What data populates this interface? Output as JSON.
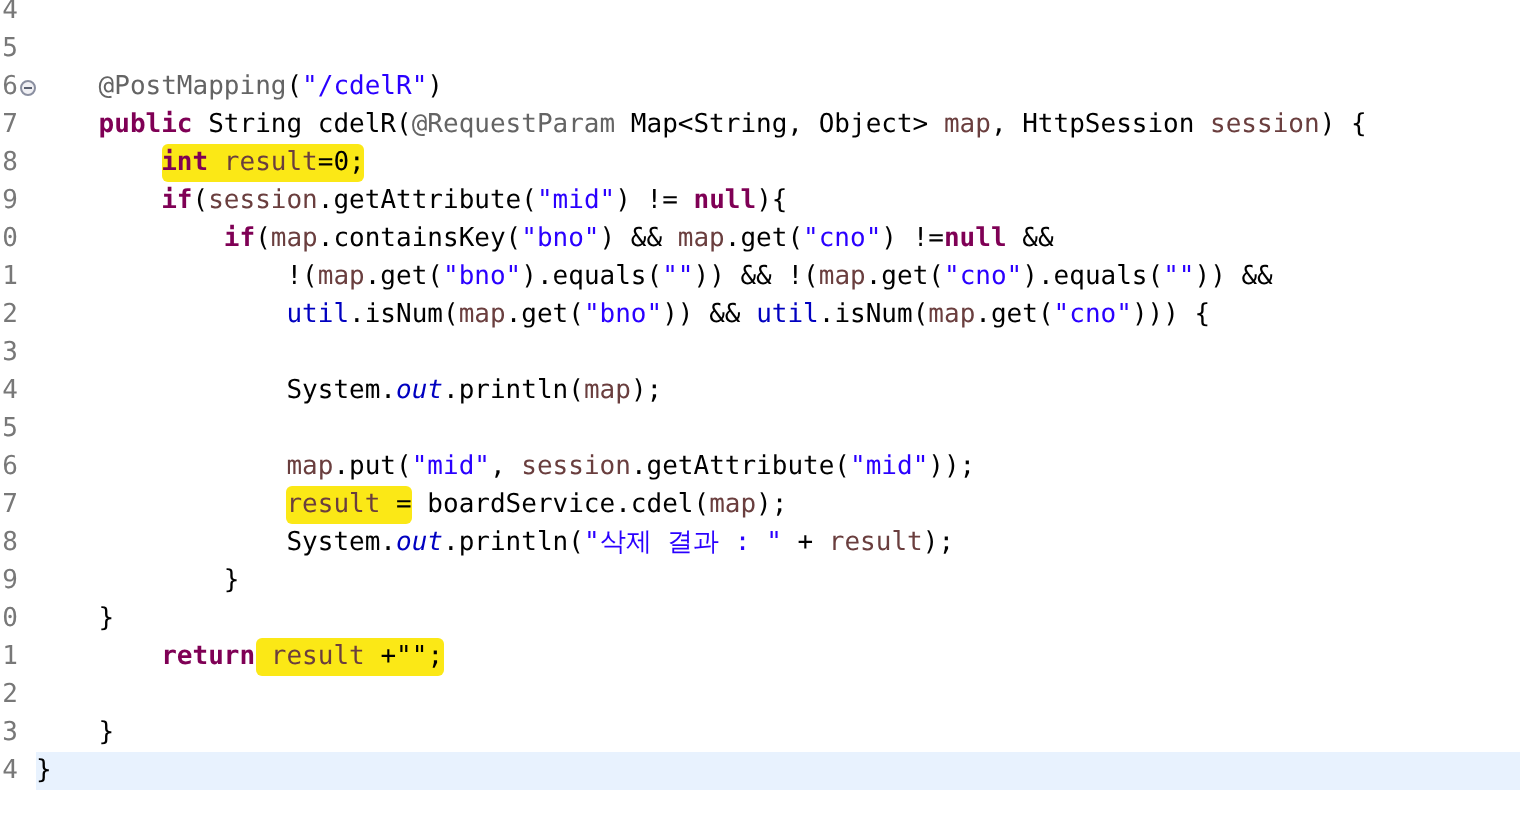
{
  "editor": {
    "lines": [
      {
        "number": "4",
        "fold": false,
        "current": false
      },
      {
        "number": "5",
        "fold": false,
        "current": false
      },
      {
        "children": [
          {
            "number": "6",
            "fold": true,
            "current": false,
            "segments": [
              {
                "marked": false,
                "tokens": [
                  {
                    "t": "@PostMapping",
                    "kind": "annotation"
                  },
                  {
                    "t": "(",
                    "kind": "plain"
                  },
                  {
                    "t": "\"/cdelR\"",
                    "kind": "string"
                  },
                  {
                    "t": ")",
                    "kind": "plain"
                  }
                ]
              }
            ]
          },
          {
            "number": "7",
            "fold": false,
            "current": false,
            "segments": [
              {
                "marked": false,
                "tokens": [
                  {
                    "t": "public",
                    "kind": "keyword"
                  },
                  {
                    "t": " String cdelR(",
                    "kind": "plain"
                  },
                  {
                    "t": "@RequestParam",
                    "kind": "annotation"
                  },
                  {
                    "t": " Map<String, Object> ",
                    "kind": "plain"
                  },
                  {
                    "t": "map",
                    "kind": "variable"
                  },
                  {
                    "t": ", HttpSession ",
                    "kind": "plain"
                  },
                  {
                    "t": "session",
                    "kind": "variable"
                  },
                  {
                    "t": ") {",
                    "kind": "plain"
                  }
                ]
              }
            ]
          },
          {
            "children": [
              {
                "number": "8",
                "fold": false,
                "current": false,
                "segments": [
                  {
                    "marked": true,
                    "tokens": [
                      {
                        "t": "int",
                        "kind": "keyword"
                      },
                      {
                        "t": " result",
                        "kind": "variable"
                      },
                      {
                        "t": "=0;",
                        "kind": "plain"
                      }
                    ]
                  }
                ]
              },
              {
                "number": "9",
                "fold": false,
                "current": false,
                "segments": [
                  {
                    "marked": false,
                    "tokens": [
                      {
                        "t": "if",
                        "kind": "keyword"
                      },
                      {
                        "t": "(",
                        "kind": "plain"
                      },
                      {
                        "t": "session",
                        "kind": "variable"
                      },
                      {
                        "t": ".getAttribute(",
                        "kind": "plain"
                      },
                      {
                        "t": "\"mid\"",
                        "kind": "string"
                      },
                      {
                        "t": ") != ",
                        "kind": "plain"
                      },
                      {
                        "t": "null",
                        "kind": "keyword"
                      },
                      {
                        "t": "){",
                        "kind": "plain"
                      }
                    ]
                  }
                ]
              },
              {
                "children": [
                  {
                    "number": "0",
                    "fold": false,
                    "current": false,
                    "segments": [
                      {
                        "marked": false,
                        "tokens": [
                          {
                            "t": "if",
                            "kind": "keyword"
                          },
                          {
                            "t": "(",
                            "kind": "plain"
                          },
                          {
                            "t": "map",
                            "kind": "variable"
                          },
                          {
                            "t": ".containsKey(",
                            "kind": "plain"
                          },
                          {
                            "t": "\"bno\"",
                            "kind": "string"
                          },
                          {
                            "t": ") && ",
                            "kind": "plain"
                          },
                          {
                            "t": "map",
                            "kind": "variable"
                          },
                          {
                            "t": ".get(",
                            "kind": "plain"
                          },
                          {
                            "t": "\"cno\"",
                            "kind": "string"
                          },
                          {
                            "t": ") !=",
                            "kind": "plain"
                          },
                          {
                            "t": "null",
                            "kind": "keyword"
                          },
                          {
                            "t": " &&",
                            "kind": "plain"
                          }
                        ]
                      }
                    ]
                  },
                  {
                    "children": [
                      {
                        "number": "1",
                        "fold": false,
                        "current": false,
                        "segments": [
                          {
                            "marked": false,
                            "tokens": [
                              {
                                "t": "!(",
                                "kind": "plain"
                              },
                              {
                                "t": "map",
                                "kind": "variable"
                              },
                              {
                                "t": ".get(",
                                "kind": "plain"
                              },
                              {
                                "t": "\"bno\"",
                                "kind": "string"
                              },
                              {
                                "t": ").equals(",
                                "kind": "plain"
                              },
                              {
                                "t": "\"\"",
                                "kind": "string"
                              },
                              {
                                "t": ")) && !(",
                                "kind": "plain"
                              },
                              {
                                "t": "map",
                                "kind": "variable"
                              },
                              {
                                "t": ".get(",
                                "kind": "plain"
                              },
                              {
                                "t": "\"cno\"",
                                "kind": "string"
                              },
                              {
                                "t": ").equals(",
                                "kind": "plain"
                              },
                              {
                                "t": "\"\"",
                                "kind": "string"
                              },
                              {
                                "t": ")) &&",
                                "kind": "plain"
                              }
                            ]
                          }
                        ]
                      },
                      {
                        "number": "2",
                        "fold": false,
                        "current": false,
                        "segments": [
                          {
                            "marked": false,
                            "tokens": [
                              {
                                "t": "util",
                                "kind": "field"
                              },
                              {
                                "t": ".isNum(",
                                "kind": "plain"
                              },
                              {
                                "t": "map",
                                "kind": "variable"
                              },
                              {
                                "t": ".get(",
                                "kind": "plain"
                              },
                              {
                                "t": "\"bno\"",
                                "kind": "string"
                              },
                              {
                                "t": ")) && ",
                                "kind": "plain"
                              },
                              {
                                "t": "util",
                                "kind": "field"
                              },
                              {
                                "t": ".isNum(",
                                "kind": "plain"
                              },
                              {
                                "t": "map",
                                "kind": "variable"
                              },
                              {
                                "t": ".get(",
                                "kind": "plain"
                              },
                              {
                                "t": "\"cno\"",
                                "kind": "string"
                              },
                              {
                                "t": "))) {",
                                "kind": "plain"
                              }
                            ]
                          }
                        ]
                      },
                      {
                        "number": "3",
                        "fold": false,
                        "current": false
                      },
                      {
                        "number": "4",
                        "fold": false,
                        "current": false,
                        "segments": [
                          {
                            "marked": false,
                            "tokens": [
                              {
                                "t": "System.",
                                "kind": "plain"
                              },
                              {
                                "t": "out",
                                "kind": "static"
                              },
                              {
                                "t": ".println(",
                                "kind": "plain"
                              },
                              {
                                "t": "map",
                                "kind": "variable"
                              },
                              {
                                "t": ");",
                                "kind": "plain"
                              }
                            ]
                          }
                        ]
                      },
                      {
                        "number": "5",
                        "fold": false,
                        "current": false
                      },
                      {
                        "number": "6",
                        "fold": false,
                        "current": false,
                        "segments": [
                          {
                            "marked": false,
                            "tokens": [
                              {
                                "t": "map",
                                "kind": "variable"
                              },
                              {
                                "t": ".put(",
                                "kind": "plain"
                              },
                              {
                                "t": "\"mid\"",
                                "kind": "string"
                              },
                              {
                                "t": ", ",
                                "kind": "plain"
                              },
                              {
                                "t": "session",
                                "kind": "variable"
                              },
                              {
                                "t": ".getAttribute(",
                                "kind": "plain"
                              },
                              {
                                "t": "\"mid\"",
                                "kind": "string"
                              },
                              {
                                "t": "));",
                                "kind": "plain"
                              }
                            ]
                          }
                        ]
                      },
                      {
                        "number": "7",
                        "fold": false,
                        "current": false,
                        "segments": [
                          {
                            "marked": true,
                            "tokens": [
                              {
                                "t": "result",
                                "kind": "variable"
                              },
                              {
                                "t": " =",
                                "kind": "plain"
                              }
                            ]
                          },
                          {
                            "marked": false,
                            "tokens": [
                              {
                                "t": " boardService.cdel(",
                                "kind": "plain"
                              },
                              {
                                "t": "map",
                                "kind": "variable"
                              },
                              {
                                "t": ");",
                                "kind": "plain"
                              }
                            ]
                          }
                        ]
                      },
                      {
                        "number": "8",
                        "fold": false,
                        "current": false,
                        "segments": [
                          {
                            "marked": false,
                            "tokens": [
                              {
                                "t": "System.",
                                "kind": "plain"
                              },
                              {
                                "t": "out",
                                "kind": "static"
                              },
                              {
                                "t": ".println(",
                                "kind": "plain"
                              },
                              {
                                "t": "\"삭제 결과 : \"",
                                "kind": "string"
                              },
                              {
                                "t": " + ",
                                "kind": "plain"
                              },
                              {
                                "t": "result",
                                "kind": "variable"
                              },
                              {
                                "t": ");",
                                "kind": "plain"
                              }
                            ]
                          }
                        ]
                      }
                    ]
                  },
                  {
                    "number": "9",
                    "fold": false,
                    "current": false,
                    "segments": [
                      {
                        "marked": false,
                        "tokens": [
                          {
                            "t": "}",
                            "kind": "plain"
                          }
                        ]
                      }
                    ]
                  }
                ]
              }
            ]
          },
          {
            "number": "0",
            "fold": false,
            "current": false,
            "segments": [
              {
                "marked": false,
                "tokens": [
                  {
                    "t": "}",
                    "kind": "plain"
                  }
                ]
              }
            ]
          },
          {
            "children": [
              {
                "number": "1",
                "fold": false,
                "current": false,
                "segments": [
                  {
                    "marked": false,
                    "tokens": [
                      {
                        "t": "return",
                        "kind": "keyword"
                      }
                    ]
                  },
                  {
                    "marked": true,
                    "tokens": [
                      {
                        "t": " result",
                        "kind": "variable"
                      },
                      {
                        "t": " +",
                        "kind": "plain"
                      },
                      {
                        "t": "\"\"",
                        "kind": "plain"
                      },
                      {
                        "t": ";",
                        "kind": "plain"
                      }
                    ]
                  }
                ]
              },
              {
                "number": "2",
                "fold": false,
                "current": false
              }
            ]
          },
          {
            "number": "3",
            "fold": false,
            "current": false,
            "segments": [
              {
                "marked": false,
                "tokens": [
                  {
                    "t": "}",
                    "kind": "plain"
                  }
                ]
              }
            ]
          }
        ]
      },
      {
        "number": "4",
        "fold": false,
        "current": true,
        "segments": [
          {
            "marked": false,
            "tokens": [
              {
                "t": "}",
                "kind": "plain"
              }
            ]
          }
        ]
      }
    ]
  }
}
